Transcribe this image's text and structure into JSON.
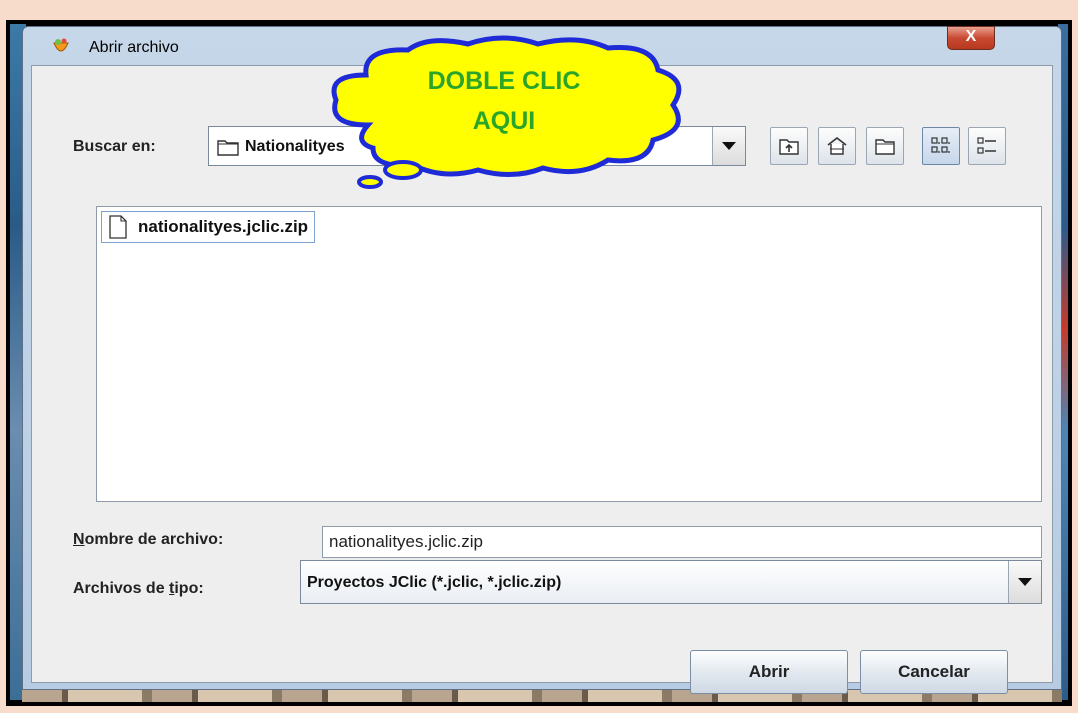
{
  "window": {
    "title": "Abrir archivo",
    "close_label": "X"
  },
  "look_in": {
    "label": "Buscar en:",
    "value": "Nationalityes"
  },
  "files": [
    {
      "name": "nationalityes.jclic.zip"
    }
  ],
  "filename": {
    "label": "Nombre de archivo:",
    "value": "nationalityes.jclic.zip"
  },
  "filetype": {
    "label": "Archivos de tipo:",
    "value": "Proyectos JClic (*.jclic, *.jclic.zip)"
  },
  "buttons": {
    "open": "Abrir",
    "cancel": "Cancelar"
  },
  "callout": {
    "line1": "DOBLE CLIC",
    "line2": "AQUI"
  },
  "toolbar": [
    "up-folder-icon",
    "home-icon",
    "new-folder-icon",
    "list-view-icon",
    "details-view-icon"
  ],
  "colors": {
    "callout_fill": "#ffff00",
    "callout_stroke": "#1f2bd6",
    "callout_text": "#2aa52a",
    "close": "#c94a32"
  }
}
